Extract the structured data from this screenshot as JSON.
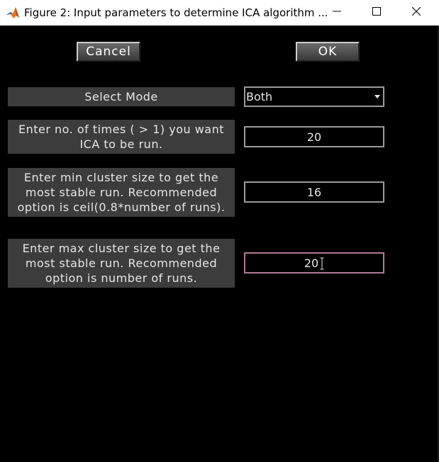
{
  "window": {
    "title": "Figure 2: Input parameters to determine ICA algorithm ..."
  },
  "buttons": {
    "cancel_label": "Cancel",
    "ok_label": "OK"
  },
  "mode": {
    "label": "Select Mode",
    "value": "Both"
  },
  "times": {
    "label": "Enter no. of times ( > 1) you want ICA to be run.",
    "value": "20"
  },
  "min_cluster": {
    "label": "Enter min cluster size to get the most stable run. Recommended option is ceil(0.8*number of runs).",
    "value": "16"
  },
  "max_cluster": {
    "label": "Enter max cluster size to get the most stable run. Recommended option is number of runs.",
    "value": "20"
  },
  "colors": {
    "background": "#000000",
    "label_bg": "#3c3c3c",
    "text": "#e6e6e6",
    "active_border": "#b07a95"
  },
  "icons": {
    "app": "matlab-icon",
    "minimize": "minimize-icon",
    "maximize": "maximize-icon",
    "close": "close-icon",
    "dropdown": "chevron-down-icon",
    "text_cursor": "text-cursor-icon"
  }
}
